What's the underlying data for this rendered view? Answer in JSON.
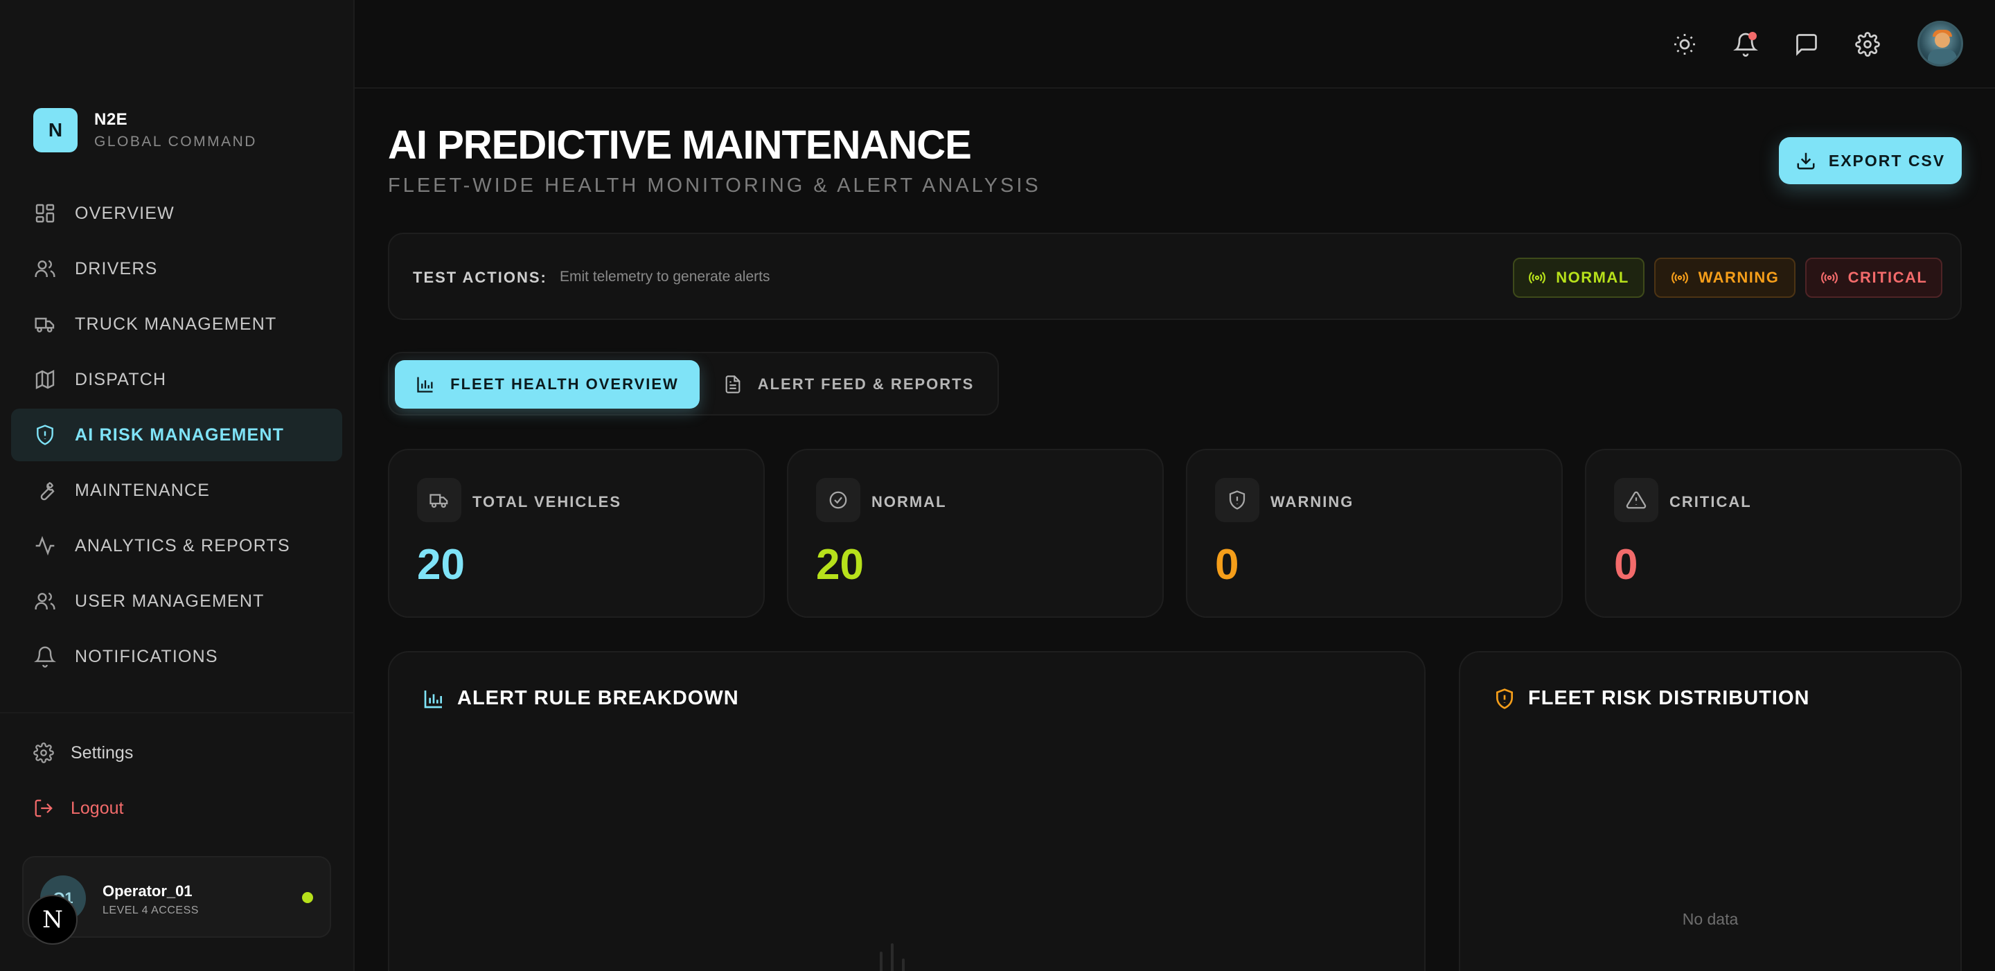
{
  "brand": {
    "logo_letter": "N",
    "name": "N2E",
    "subtitle": "GLOBAL COMMAND"
  },
  "nav": {
    "items": [
      {
        "label": "OVERVIEW",
        "icon": "grid-icon",
        "active": false
      },
      {
        "label": "DRIVERS",
        "icon": "users-icon",
        "active": false
      },
      {
        "label": "TRUCK MANAGEMENT",
        "icon": "truck-icon",
        "active": false
      },
      {
        "label": "DISPATCH",
        "icon": "map-icon",
        "active": false
      },
      {
        "label": "AI RISK MANAGEMENT",
        "icon": "shield-icon",
        "active": true
      },
      {
        "label": "MAINTENANCE",
        "icon": "wrench-icon",
        "active": false
      },
      {
        "label": "ANALYTICS & REPORTS",
        "icon": "activity-icon",
        "active": false
      },
      {
        "label": "USER MANAGEMENT",
        "icon": "users-icon",
        "active": false
      },
      {
        "label": "NOTIFICATIONS",
        "icon": "bell-icon",
        "active": false
      }
    ],
    "settings_label": "Settings",
    "logout_label": "Logout"
  },
  "user": {
    "name": "Operator_01",
    "level": "LEVEL 4 ACCESS",
    "initials": "O1",
    "status_color": "#b7e11b"
  },
  "badge": {
    "letter": "N"
  },
  "topbar": {
    "icons": [
      "sun-icon",
      "bell-icon",
      "message-icon",
      "gear-icon",
      "avatar"
    ]
  },
  "header": {
    "title": "AI PREDICTIVE MAINTENANCE",
    "subtitle": "FLEET-WIDE HEALTH MONITORING & ALERT ANALYSIS",
    "export_label": "EXPORT CSV"
  },
  "test_actions": {
    "label": "TEST ACTIONS:",
    "description": "Emit telemetry to generate alerts",
    "buttons": {
      "normal": "NORMAL",
      "warning": "WARNING",
      "critical": "CRITICAL"
    }
  },
  "tabs": [
    {
      "label": "FLEET HEALTH OVERVIEW",
      "active": true
    },
    {
      "label": "ALERT FEED & REPORTS",
      "active": false
    }
  ],
  "stats": [
    {
      "label": "TOTAL VEHICLES",
      "value": "20",
      "color": "#7fe3f7",
      "icon": "truck-icon"
    },
    {
      "label": "NORMAL",
      "value": "20",
      "color": "#b7e11b",
      "icon": "check-circle-icon"
    },
    {
      "label": "WARNING",
      "value": "0",
      "color": "#f59e1a",
      "icon": "shield-alert-icon"
    },
    {
      "label": "CRITICAL",
      "value": "0",
      "color": "#f36b6b",
      "icon": "alert-triangle-icon"
    }
  ],
  "panels": {
    "alert_rules": {
      "title": "ALERT RULE BREAKDOWN"
    },
    "risk_distribution": {
      "title": "FLEET RISK DISTRIBUTION",
      "empty_text": "No data"
    }
  },
  "colors": {
    "accent": "#7fe3f7",
    "normal": "#b7e11b",
    "warning": "#f59e1a",
    "critical": "#f36b6b"
  }
}
